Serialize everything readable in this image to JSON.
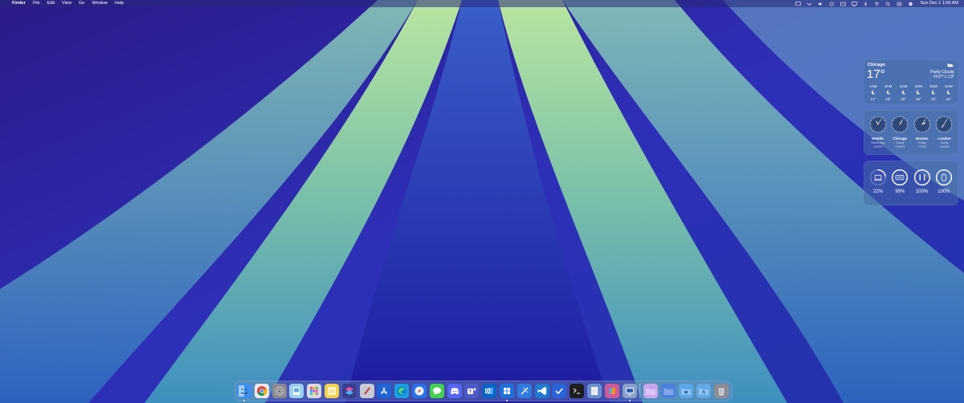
{
  "menubar": {
    "apple_glyph": "",
    "app_name": "Finder",
    "menus": [
      "File",
      "Edit",
      "View",
      "Go",
      "Window",
      "Help"
    ],
    "status_icons": [
      "screen-mirroring-icon",
      "control-icon",
      "volume-icon",
      "creative-cloud-icon",
      "keyboard-icon",
      "display-icon",
      "bluetooth-icon",
      "wifi-icon",
      "spotlight-icon",
      "control-center-icon",
      "siri-icon"
    ],
    "datetime": "Sun Dec 1  1:05 AM"
  },
  "weather": {
    "city": "Chicago",
    "temp": "17°",
    "condition": "Partly Cloudy",
    "hilo": "H:27° L:13°",
    "hours": [
      {
        "time": "1AM",
        "temp": "17°"
      },
      {
        "time": "2AM",
        "temp": "16°"
      },
      {
        "time": "3AM",
        "temp": "15°"
      },
      {
        "time": "4AM",
        "temp": "15°"
      },
      {
        "time": "5AM",
        "temp": "14°"
      },
      {
        "time": "6AM",
        "temp": "14°"
      }
    ]
  },
  "clocks": [
    {
      "city": "Seattle",
      "day": "Yesterday",
      "offset": "-2HRS",
      "hour": 11,
      "minute": 5
    },
    {
      "city": "Chicago",
      "day": "Today",
      "offset": "+0HRS",
      "hour": 1,
      "minute": 5
    },
    {
      "city": "Boston",
      "day": "Today",
      "offset": "+1HR",
      "hour": 2,
      "minute": 5
    },
    {
      "city": "London",
      "day": "Today",
      "offset": "+6HRS",
      "hour": 7,
      "minute": 5
    }
  ],
  "batteries": [
    {
      "device": "mac-battery-icon",
      "level": 22,
      "label": "22%"
    },
    {
      "device": "keyboard-battery-icon",
      "level": 99,
      "label": "99%"
    },
    {
      "device": "airpods-battery-icon",
      "level": 100,
      "label": "100%"
    },
    {
      "device": "mouse-battery-icon",
      "level": 100,
      "label": "100%"
    }
  ],
  "dock": {
    "apps": [
      {
        "name": "finder-icon",
        "color": "#3d8ef0"
      },
      {
        "name": "chrome-icon",
        "color": "#e9e9f0"
      },
      {
        "name": "settings-icon",
        "color": "#8a8a90"
      },
      {
        "name": "preview-icon",
        "color": "#9bd0f2"
      },
      {
        "name": "launchpad-icon",
        "color": "#d8d8e0"
      },
      {
        "name": "notes-icon",
        "color": "#f3d24c"
      },
      {
        "name": "shortcuts-icon",
        "color": "#3b3f8f"
      },
      {
        "name": "pencil-icon",
        "color": "#c9c9d6"
      },
      {
        "name": "app-store-icon",
        "color": "#1c64d8"
      },
      {
        "name": "edge-icon",
        "color": "#1a9fe0"
      },
      {
        "name": "safari-icon",
        "color": "#2a6ee8"
      },
      {
        "name": "messages-icon",
        "color": "#44cf53"
      },
      {
        "name": "discord-icon",
        "color": "#5865f2"
      },
      {
        "name": "teams-icon",
        "color": "#5059c9"
      },
      {
        "name": "outlook-icon",
        "color": "#0a64c4"
      },
      {
        "name": "windows-app-icon",
        "color": "#1e6fd9"
      },
      {
        "name": "xcode-icon",
        "color": "#2f7be0"
      },
      {
        "name": "vscode-icon",
        "color": "#1f7ad0"
      },
      {
        "name": "todo-icon",
        "color": "#2b63d8"
      },
      {
        "name": "terminal-icon",
        "color": "#1e1e1e"
      },
      {
        "name": "textedit-icon",
        "color": "#6e8fd0"
      },
      {
        "name": "copilot-icon",
        "color": "#d05a98"
      },
      {
        "name": "screen-sharing-icon",
        "color": "#8aa0c8"
      }
    ],
    "folders": [
      {
        "name": "folder-icon",
        "color": "#c9a6f0"
      },
      {
        "name": "downloads-folder-icon",
        "color": "#4d7fe0"
      },
      {
        "name": "screenshots-folder-icon",
        "color": "#5aa6e8"
      },
      {
        "name": "applications-folder-icon",
        "color": "#60a8e6"
      },
      {
        "name": "trash-icon",
        "color": "#8c8c96"
      }
    ]
  }
}
